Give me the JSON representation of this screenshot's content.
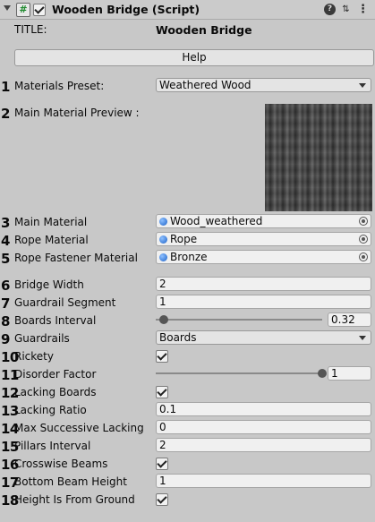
{
  "header": {
    "title": "Wooden Bridge (Script)",
    "script_icon": "#",
    "help_icon": "?",
    "settings_icon": "⇅",
    "menu_icon": "⋮"
  },
  "title_label": "TITLE:",
  "title_value": "Wooden Bridge",
  "help_button": "Help",
  "fields": {
    "materials_preset": {
      "num": "1",
      "label": "Materials Preset:",
      "value": "Weathered Wood"
    },
    "main_material_preview": {
      "num": "2",
      "label": "Main Material Preview :"
    },
    "main_material": {
      "num": "3",
      "label": "Main Material",
      "value": "Wood_weathered"
    },
    "rope_material": {
      "num": "4",
      "label": "Rope Material",
      "value": "Rope"
    },
    "rope_fastener_material": {
      "num": "5",
      "label": "Rope Fastener Material",
      "value": "Bronze"
    },
    "bridge_width": {
      "num": "6",
      "label": "Bridge Width",
      "value": "2"
    },
    "guardrail_segment": {
      "num": "7",
      "label": "Guardrail Segment",
      "value": "1"
    },
    "boards_interval": {
      "num": "8",
      "label": "Boards Interval",
      "value": "0.32",
      "slider_fraction": 0.05
    },
    "guardrails": {
      "num": "9",
      "label": "Guardrails",
      "value": "Boards"
    },
    "rickety": {
      "num": "10",
      "label": "Rickety",
      "checked": true
    },
    "disorder_factor": {
      "num": "11",
      "label": "Disorder Factor",
      "value": "1",
      "slider_fraction": 1.0
    },
    "lacking_boards": {
      "num": "12",
      "label": "Lacking Boards",
      "checked": true
    },
    "lacking_ratio": {
      "num": "13",
      "label": "Lacking Ratio",
      "value": "0.1"
    },
    "max_successive_lacking": {
      "num": "14",
      "label": "Max Successive Lacking",
      "value": "0"
    },
    "pillars_interval": {
      "num": "15",
      "label": "Pillars Interval",
      "value": "2"
    },
    "crosswise_beams": {
      "num": "16",
      "label": "Crosswise Beams",
      "checked": true
    },
    "bottom_beam_height": {
      "num": "17",
      "label": "Bottom Beam Height",
      "value": "1"
    },
    "height_is_from_ground": {
      "num": "18",
      "label": "Height Is From Ground",
      "checked": true
    }
  }
}
